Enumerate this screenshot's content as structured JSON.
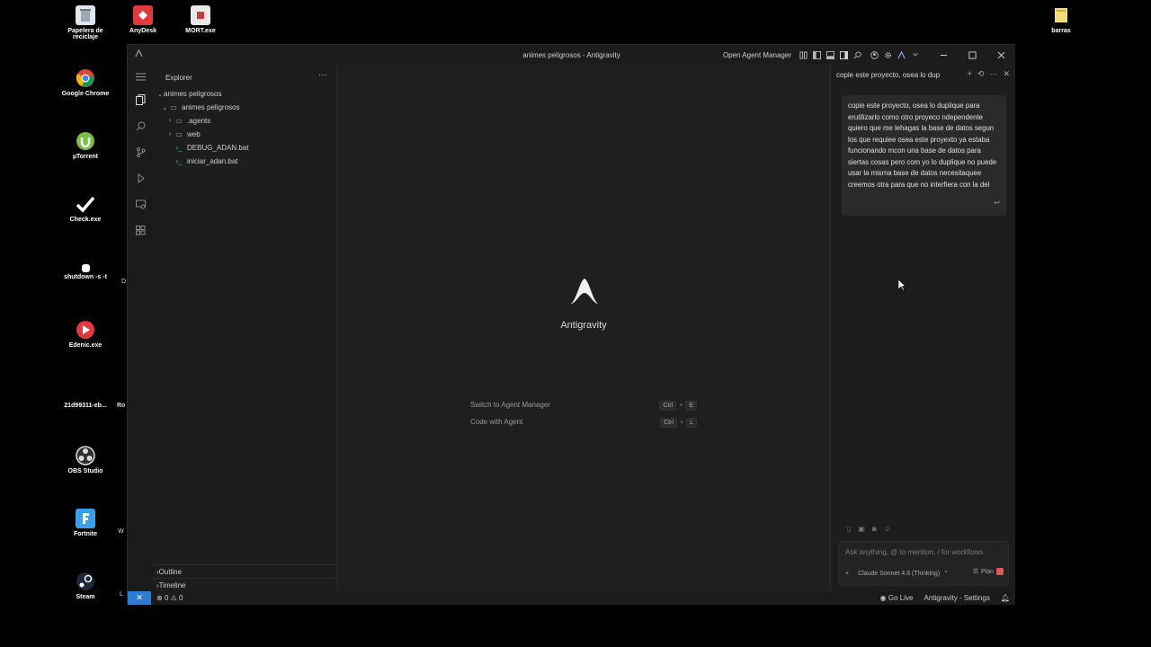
{
  "desktop": {
    "icons": [
      {
        "label": "Papelera de reciclaje",
        "icon": "recycle-bin-icon"
      },
      {
        "label": "AnyDesk",
        "icon": "anydesk-icon"
      },
      {
        "label": "MORT.exe",
        "icon": "exe-icon"
      },
      {
        "label": "barras",
        "icon": "folder-icon"
      },
      {
        "label": "Google Chrome",
        "icon": "chrome-icon"
      },
      {
        "label": "µTorrent",
        "icon": "utorrent-icon"
      },
      {
        "label": "Check.exe",
        "icon": "check-icon"
      },
      {
        "label": "shutdown -s -t",
        "icon": "shortcut-icon"
      },
      {
        "label": "Edenic.exe",
        "icon": "play-icon"
      },
      {
        "label": "21d99311-eb...",
        "icon": "file-icon"
      },
      {
        "label": "OBS Studio",
        "icon": "obs-icon"
      },
      {
        "label": "Fortnite",
        "icon": "fortnite-icon"
      },
      {
        "label": "Steam",
        "icon": "steam-icon"
      }
    ],
    "edge_fragments": [
      "D",
      "Ro",
      "W",
      "L"
    ]
  },
  "window": {
    "title": "animes peligrosos - Antigravity",
    "open_agent_manager": "Open Agent Manager"
  },
  "sidebar": {
    "header": "Explorer",
    "more": "···",
    "tree": [
      {
        "label": "animes peligrosos",
        "type": "root"
      },
      {
        "label": "animes peligrosos",
        "type": "folder-open"
      },
      {
        "label": ".agents",
        "type": "folder"
      },
      {
        "label": "web",
        "type": "folder"
      },
      {
        "label": "DEBUG_ADAN.bat",
        "type": "file"
      },
      {
        "label": "iniciar_adan.bat",
        "type": "file"
      }
    ],
    "outline": "Outline",
    "timeline": "Timeline"
  },
  "editor": {
    "brand": "Antigravity",
    "shortcuts": [
      {
        "label": "Switch to Agent Manager",
        "mod": "Ctrl",
        "key": "E"
      },
      {
        "label": "Code with Agent",
        "mod": "Ctrl",
        "key": "L"
      }
    ]
  },
  "agent": {
    "header": "copie este proyecto, osea lo dup",
    "message": "copie este proyecto, osea lo duplique para erutilizarlo como otro proyeco ndependente quiero que me lehagas la base de datos segun los que requiee osea este proyexto ya estaba funcionando mcon una base de datos para siertas cosas pero com yo lo duplique no puede usar la misma base de datos necesitaquee creemos otra para que no interfiera con la del",
    "input_placeholder": "Ask anything, @ to mention, / for workflows",
    "model": "Claude Sonnet 4.6 (Thinking)",
    "mode": "Plan",
    "stop_color": "#e05555"
  },
  "status": {
    "errors": "0",
    "warnings": "0",
    "go_live": "Go Live",
    "settings": "Antigravity - Settings"
  },
  "colors": {
    "remote": "#2e7bcf",
    "file_icon": "#3fbf8a"
  }
}
